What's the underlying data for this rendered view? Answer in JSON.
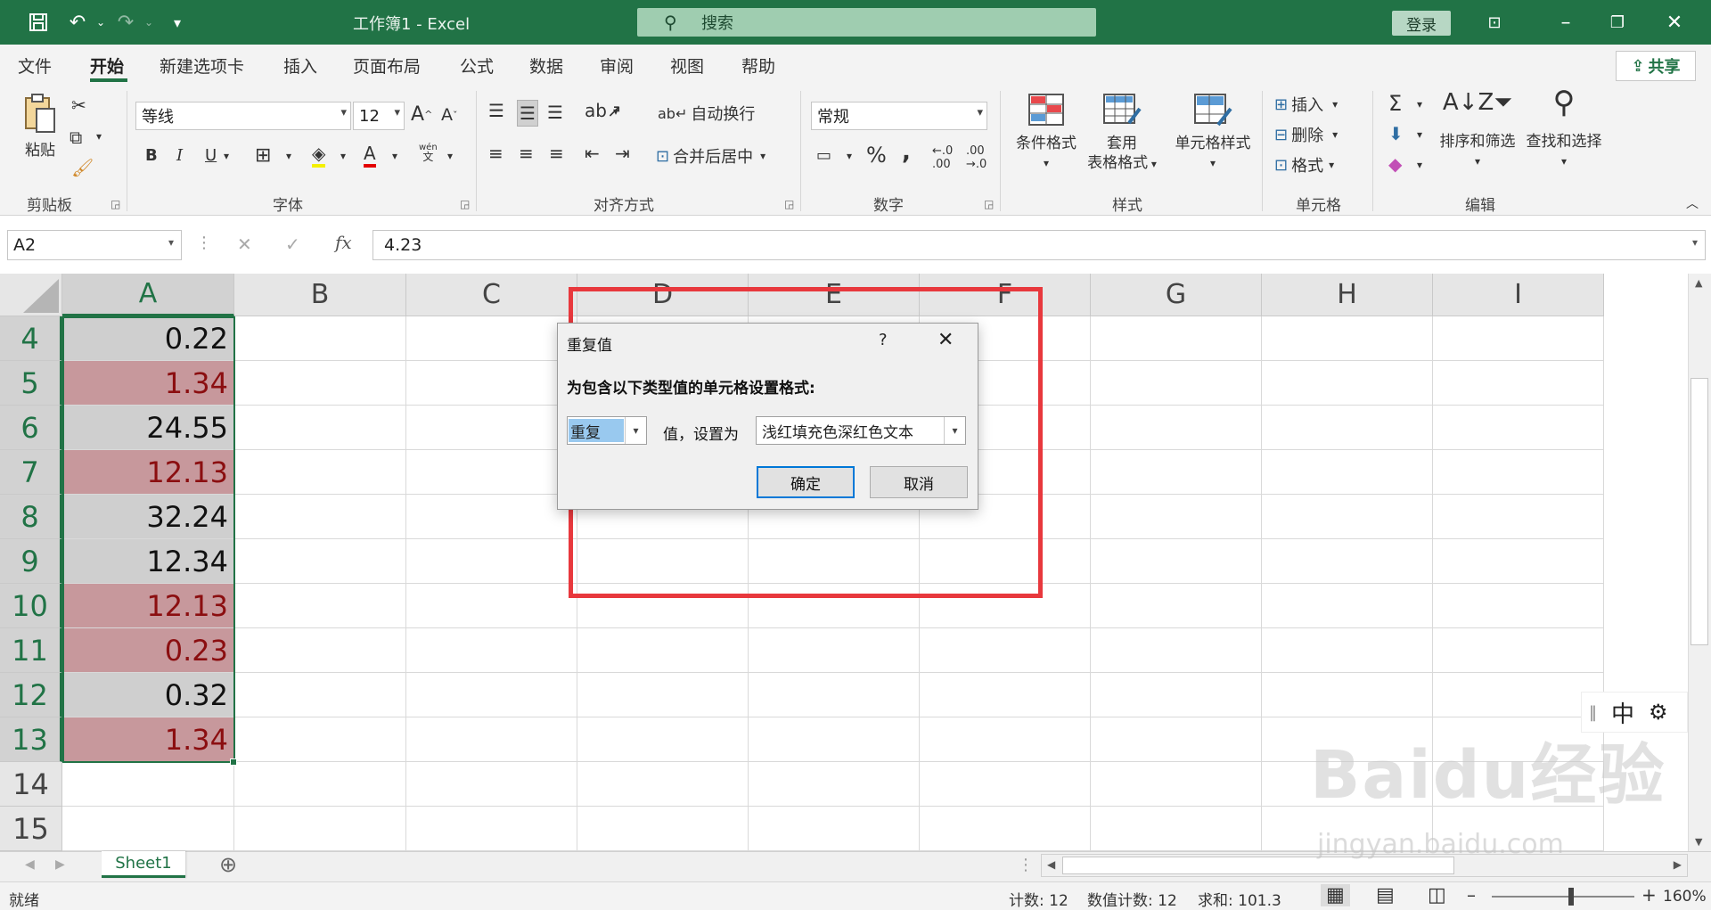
{
  "titlebar": {
    "title": "工作簿1 - Excel",
    "search_placeholder": "搜索",
    "login_label": "登录"
  },
  "menu": {
    "tabs": [
      "文件",
      "开始",
      "新建选项卡",
      "插入",
      "页面布局",
      "公式",
      "数据",
      "审阅",
      "视图",
      "帮助"
    ],
    "share_label": "共享"
  },
  "ribbon": {
    "clipboard": {
      "paste_label": "粘贴",
      "group_label": "剪贴板"
    },
    "font": {
      "font_name": "等线",
      "font_size": "12",
      "bold": "B",
      "italic": "I",
      "underline": "U",
      "group_label": "字体",
      "phonetic": "wén"
    },
    "alignment": {
      "wrap_text": "自动换行",
      "merge_center": "合并后居中",
      "group_label": "对齐方式"
    },
    "number": {
      "format": "常规",
      "percent": "%",
      "comma": ",",
      "group_label": "数字"
    },
    "styles": {
      "conditional_format": "条件格式",
      "table_format_1": "套用",
      "table_format_2": "表格格式",
      "cell_styles": "单元格样式",
      "group_label": "样式"
    },
    "cells": {
      "insert": "插入",
      "delete": "删除",
      "format": "格式",
      "group_label": "单元格"
    },
    "editing": {
      "sort_filter": "排序和筛选",
      "find_select": "查找和选择",
      "group_label": "编辑"
    }
  },
  "formula_bar": {
    "name_box": "A2",
    "fx": "fx",
    "value": "4.23"
  },
  "grid": {
    "columns": [
      "A",
      "B",
      "C",
      "D",
      "E",
      "F",
      "G",
      "H",
      "I"
    ],
    "rows": [
      {
        "num": "4",
        "a": "0.22",
        "dup": false
      },
      {
        "num": "5",
        "a": "1.34",
        "dup": true
      },
      {
        "num": "6",
        "a": "24.55",
        "dup": false
      },
      {
        "num": "7",
        "a": "12.13",
        "dup": true
      },
      {
        "num": "8",
        "a": "32.24",
        "dup": false
      },
      {
        "num": "9",
        "a": "12.34",
        "dup": false
      },
      {
        "num": "10",
        "a": "12.13",
        "dup": true
      },
      {
        "num": "11",
        "a": "0.23",
        "dup": true
      },
      {
        "num": "12",
        "a": "0.32",
        "dup": false
      },
      {
        "num": "13",
        "a": "1.34",
        "dup": true
      },
      {
        "num": "14",
        "a": "",
        "dup": false
      },
      {
        "num": "15",
        "a": "",
        "dup": false
      }
    ]
  },
  "dialog": {
    "title": "重复值",
    "help": "?",
    "prompt": "为包含以下类型值的单元格设置格式:",
    "type_value": "重复",
    "middle_text": "值，设置为",
    "format_value": "浅红填充色深红色文本",
    "ok_label": "确定",
    "cancel_label": "取消"
  },
  "ime": {
    "mode": "中"
  },
  "sheets": {
    "tabs": [
      "Sheet1"
    ]
  },
  "status": {
    "ready": "就绪",
    "count": "计数: 12",
    "numeric_count": "数值计数: 12",
    "sum": "求和: 101.3",
    "zoom": "160%"
  },
  "watermark": {
    "brand": "Baidu经验",
    "url": "jingyan.baidu.com"
  },
  "colors": {
    "excel_green": "#217346",
    "dup_fill": "#c7989c",
    "dup_text": "#8b0e10",
    "highlight_rect": "#e8383d"
  }
}
